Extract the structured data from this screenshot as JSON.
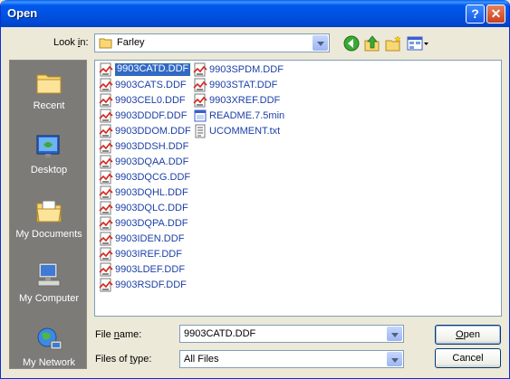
{
  "window": {
    "title": "Open",
    "help_label": "?",
    "close_label": "✕"
  },
  "lookin": {
    "label_pre": "Look ",
    "label_key": "i",
    "label_post": "n:",
    "value": "Farley"
  },
  "toolbar": {
    "back": "back-icon",
    "up": "up-folder-icon",
    "newfolder": "new-folder-icon",
    "views": "views-menu-icon"
  },
  "places": [
    {
      "label": "Recent",
      "icon": "recent-icon"
    },
    {
      "label": "Desktop",
      "icon": "desktop-icon"
    },
    {
      "label": "My Documents",
      "icon": "my-documents-icon"
    },
    {
      "label": "My Computer",
      "icon": "my-computer-icon"
    },
    {
      "label": "My Network",
      "icon": "my-network-icon"
    }
  ],
  "files": [
    {
      "name": "9903CATD.DDF",
      "type": "ddf",
      "selected": true
    },
    {
      "name": "9903CATS.DDF",
      "type": "ddf"
    },
    {
      "name": "9903CEL0.DDF",
      "type": "ddf"
    },
    {
      "name": "9903DDDF.DDF",
      "type": "ddf"
    },
    {
      "name": "9903DDOM.DDF",
      "type": "ddf"
    },
    {
      "name": "9903DDSH.DDF",
      "type": "ddf"
    },
    {
      "name": "9903DQAA.DDF",
      "type": "ddf"
    },
    {
      "name": "9903DQCG.DDF",
      "type": "ddf"
    },
    {
      "name": "9903DQHL.DDF",
      "type": "ddf"
    },
    {
      "name": "9903DQLC.DDF",
      "type": "ddf"
    },
    {
      "name": "9903DQPA.DDF",
      "type": "ddf"
    },
    {
      "name": "9903IDEN.DDF",
      "type": "ddf"
    },
    {
      "name": "9903IREF.DDF",
      "type": "ddf"
    },
    {
      "name": "9903LDEF.DDF",
      "type": "ddf"
    },
    {
      "name": "9903RSDF.DDF",
      "type": "ddf"
    },
    {
      "name": "9903SPDM.DDF",
      "type": "ddf"
    },
    {
      "name": "9903STAT.DDF",
      "type": "ddf"
    },
    {
      "name": "9903XREF.DDF",
      "type": "ddf"
    },
    {
      "name": "README.7.5min",
      "type": "app"
    },
    {
      "name": "UCOMMENT.txt",
      "type": "txt"
    }
  ],
  "filename": {
    "label_pre": "File ",
    "label_key": "n",
    "label_post": "ame:",
    "value": "9903CATD.DDF"
  },
  "filetype": {
    "label_pre": "Files of ",
    "label_key": "t",
    "label_post": "ype:",
    "value": "All Files"
  },
  "buttons": {
    "open_key": "O",
    "open_rest": "pen",
    "cancel": "Cancel"
  },
  "colors": {
    "title_blue": "#0054E3",
    "selection": "#316AC5",
    "file_text": "#1B3FA6",
    "places_bg": "#7C7B78"
  }
}
